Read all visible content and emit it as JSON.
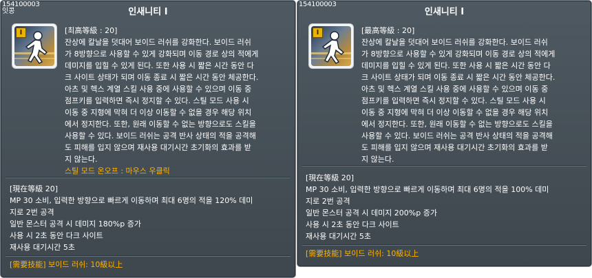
{
  "left": {
    "code": "154100003",
    "sub": "잇콩",
    "title": "인새니티 I",
    "max_level": "[최高等級 : 20]",
    "desc_lines": [
      "잔상에 칼날을 덧대어 보이드 러쉬를 강화한다. 보이드 러쉬",
      "가 8방향으로 사용할 수 있게 강화되며 이동 경로 상의 적에게",
      "데미지를 입힐 수 있게 된다. 또한 사용 시 짧은 시간 동안 다",
      "크 사이트 상태가 되며 이동 종료 시 짧은 시간 동안 체공한다.",
      "아츠 및 헥스 계열 스킬 사용 중에 사용할 수 있으며 이동 중",
      "점프키를 입력하면 즉시 정지할 수 있다. 스틸 모드 사용 시",
      "이동 중 지형에 막혀 더 이상 이동할 수 없을 경우 해당 위치",
      "에서 정지한다. 또한, 원래 이동할 수 없는 방향으로도 스킬을",
      "사용할 수 있다. 보이드 러쉬는 공격 반사 상태의 적을 공격해",
      "도 피해를 입지 않으며 재사용 대기시간 초기화의 효과를 받",
      "지 않는다."
    ],
    "hint": "스틸 모드 온오프 : 마우스 우클릭",
    "cur_level": "[現在等級 20]",
    "lvl_lines": [
      "MP 30 소비, 입력한 방향으로 빠르게 이동하며 최대 6명의 적을 120% 데미",
      "지로 2번 공격",
      "일반 몬스터 공격 시 데미지 180%p 증가",
      "사용 시 2초 동안 다크 사이트",
      "재사용 대기시간 5초"
    ],
    "req_label": "[需要技能]",
    "req_text": " 보이드 러쉬: 10級以上"
  },
  "right": {
    "code": "154100003",
    "title": "인새니티 I",
    "max_level": "[最高等級 : 20]",
    "desc_lines": [
      "잔상에 칼날을 덧대어 보이드 러쉬를 강화한다. 보이드 러쉬",
      "가 8방향으로 사용할 수 있게 강화되며 이동 경로 상의 적에게",
      "데미지를 입힐 수 있게 된다. 또한 사용 시 짧은 시간 동안 다",
      "크 사이트 상태가 되며 이동 종료 시 짧은 시간 동안 체공한다.",
      "아츠 및 헥스 계열 스킬 사용 중에 사용할 수 있으며 이동 중",
      "점프키를 입력하면 즉시 정지할 수 있다. 스틸 모드 사용 시",
      "이동 중 지형에 막혀 더 이상 이동할 수 없을 경우 해당 위치",
      "에서 정지한다. 또한, 원래 이동할 수 없는 방향으로도 스킬을",
      "사용할 수 있다. 보이드 러쉬는 공격 반사 상태의 적을 공격해",
      "도 피해를 입지 않으며 재사용 대기시간 초기화의 효과를 받",
      "지 않는다."
    ],
    "cur_level": "[現在等級 20]",
    "lvl_lines": [
      "MP 30 소비, 입력한 방향으로 빠르게 이동하며 최대 6명의 적을 100% 데미",
      "지로 2번 공격",
      "일반 몬스터 공격 시 데미지 200%p 증가",
      "사용 시 2초 동안 다크 사이트",
      "재사용 대기시간 5초"
    ],
    "req_label": "[需要技能]",
    "req_text": " 보이드 러쉬: 10級以上"
  },
  "icon": {
    "name": "skill-insanity-icon",
    "roman": "I"
  }
}
